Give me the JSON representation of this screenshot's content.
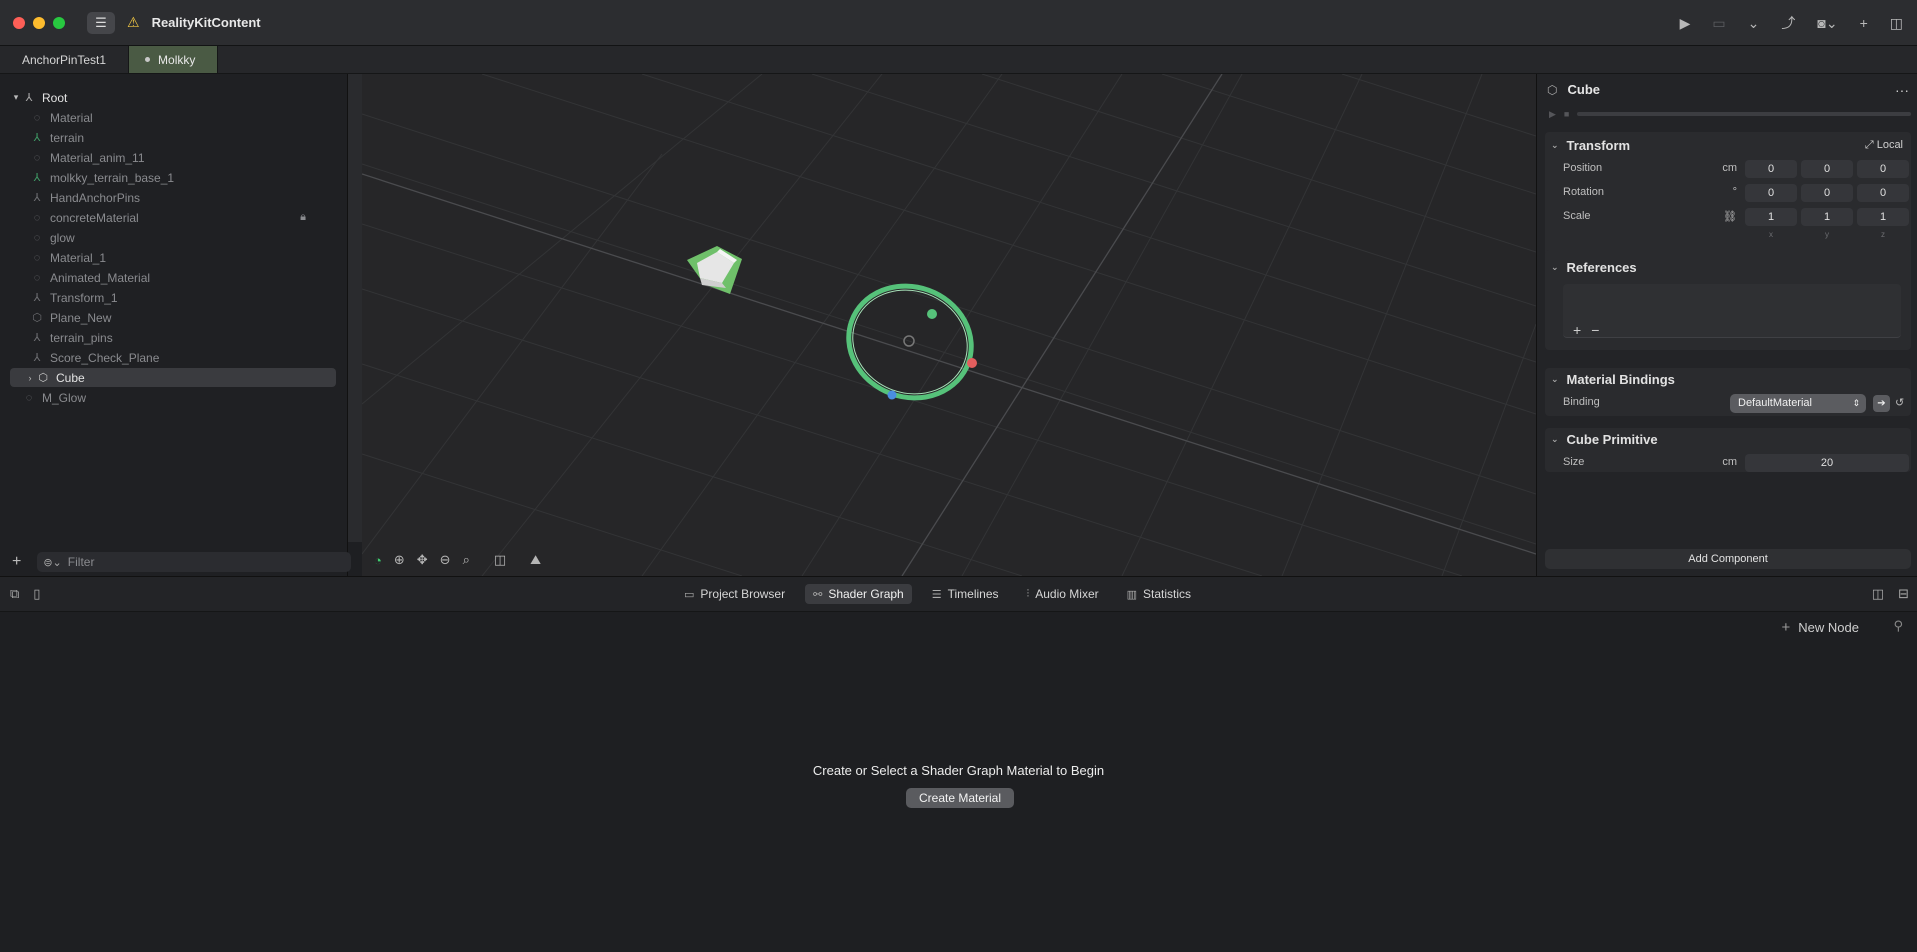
{
  "window": {
    "title": "RealityKitContent"
  },
  "tabs": [
    {
      "label": "AnchorPinTest1"
    },
    {
      "label": "Molkky"
    }
  ],
  "hierarchy": {
    "root": "Root",
    "items": [
      {
        "label": "Material"
      },
      {
        "label": "terrain"
      },
      {
        "label": "Material_anim_11"
      },
      {
        "label": "molkky_terrain_base_1"
      },
      {
        "label": "HandAnchorPins"
      },
      {
        "label": "concreteMaterial"
      },
      {
        "label": "glow"
      },
      {
        "label": "Material_1"
      },
      {
        "label": "Animated_Material"
      },
      {
        "label": "Transform_1"
      },
      {
        "label": "Plane_New"
      },
      {
        "label": "terrain_pins"
      },
      {
        "label": "Score_Check_Plane"
      },
      {
        "label": "Cube"
      }
    ],
    "outside": "M_Glow",
    "filter_placeholder": "Filter"
  },
  "inspector": {
    "title": "Cube",
    "transform": {
      "title": "Transform",
      "space": "Local",
      "position_label": "Position",
      "position_unit": "cm",
      "position": [
        "0",
        "0",
        "0"
      ],
      "rotation_label": "Rotation",
      "rotation_unit": "°",
      "rotation": [
        "0",
        "0",
        "0"
      ],
      "scale_label": "Scale",
      "scale": [
        "1",
        "1",
        "1"
      ],
      "axes": [
        "x",
        "y",
        "z"
      ]
    },
    "references": {
      "title": "References"
    },
    "material_bindings": {
      "title": "Material Bindings",
      "binding_label": "Binding",
      "binding_value": "DefaultMaterial"
    },
    "cube_primitive": {
      "title": "Cube Primitive",
      "size_label": "Size",
      "size_unit": "cm",
      "size_value": "20"
    },
    "add_component": "Add Component"
  },
  "bottom": {
    "tabs": [
      {
        "label": "Project Browser"
      },
      {
        "label": "Shader Graph"
      },
      {
        "label": "Timelines"
      },
      {
        "label": "Audio Mixer"
      },
      {
        "label": "Statistics"
      }
    ],
    "new_node": "New Node",
    "empty_message": "Create or Select a Shader Graph Material to Begin",
    "create_button": "Create Material"
  },
  "colors": {
    "accent_green": "#3fcf70",
    "active_tab": "#4a5a44"
  }
}
